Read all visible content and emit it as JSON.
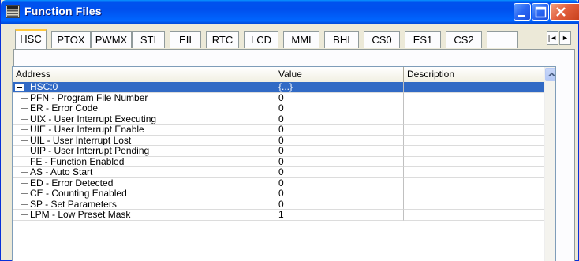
{
  "window": {
    "title": "Function Files",
    "title_icon": "function-files-icon",
    "buttons": {
      "minimize": "minimize-icon",
      "maximize": "maximize-icon",
      "close": "close-icon"
    }
  },
  "tabs": [
    {
      "label": "HSC",
      "active": true
    },
    {
      "label": "PTOX",
      "active": false
    },
    {
      "label": "PWMX",
      "active": false
    },
    {
      "label": "STI",
      "active": false
    },
    {
      "label": "EII",
      "active": false
    },
    {
      "label": "RTC",
      "active": false
    },
    {
      "label": "LCD",
      "active": false
    },
    {
      "label": "MMI",
      "active": false
    },
    {
      "label": "BHI",
      "active": false
    },
    {
      "label": "CS0",
      "active": false
    },
    {
      "label": "ES1",
      "active": false
    },
    {
      "label": "CS2",
      "active": false
    }
  ],
  "tab_scroll": {
    "left": "|◄",
    "right": "►"
  },
  "grid": {
    "columns": {
      "address": "Address",
      "value": "Value",
      "description": "Description"
    },
    "rows": [
      {
        "address": "HSC:0",
        "value": "{...}",
        "description": "",
        "selected": true,
        "expanded": true
      },
      {
        "address": "PFN - Program File Number",
        "value": "0",
        "description": ""
      },
      {
        "address": "ER - Error Code",
        "value": "0",
        "description": ""
      },
      {
        "address": "UIX - User Interrupt Executing",
        "value": "0",
        "description": ""
      },
      {
        "address": "UIE - User Interrupt Enable",
        "value": "0",
        "description": ""
      },
      {
        "address": "UIL - User Interrupt Lost",
        "value": "0",
        "description": ""
      },
      {
        "address": "UIP - User Interrupt Pending",
        "value": "0",
        "description": ""
      },
      {
        "address": "FE - Function Enabled",
        "value": "0",
        "description": ""
      },
      {
        "address": "AS - Auto Start",
        "value": "0",
        "description": ""
      },
      {
        "address": "ED - Error Detected",
        "value": "0",
        "description": ""
      },
      {
        "address": "CE - Counting Enabled",
        "value": "0",
        "description": ""
      },
      {
        "address": "SP - Set Parameters",
        "value": "0",
        "description": ""
      },
      {
        "address": "LPM - Low Preset Mask",
        "value": "1",
        "description": ""
      }
    ]
  },
  "colors": {
    "titlebar": "#0053ee",
    "selection": "#316ac5",
    "active_tab_accent": "#ffc83c"
  }
}
